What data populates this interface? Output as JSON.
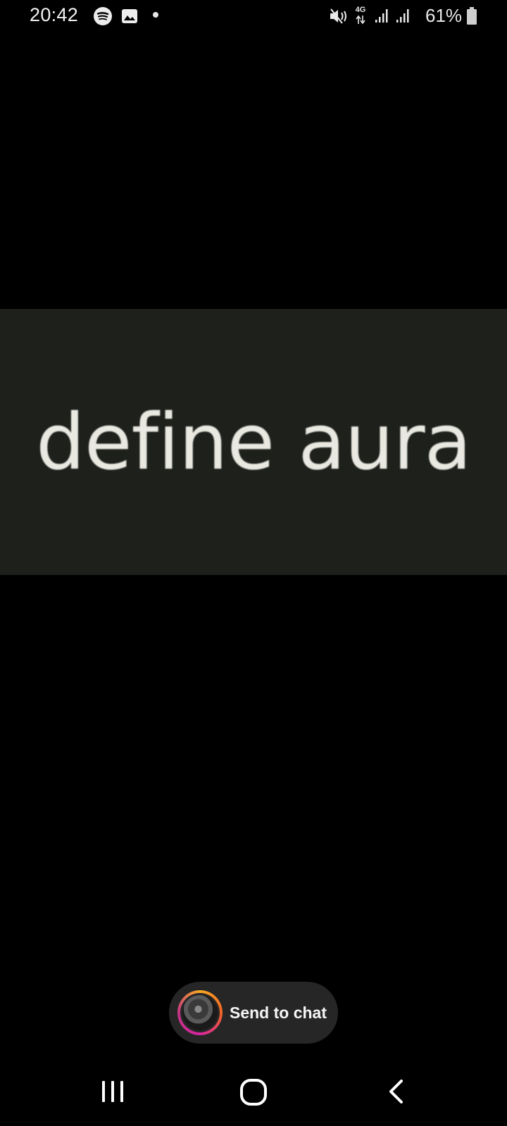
{
  "status_bar": {
    "time": "20:42",
    "network_type": "4G",
    "battery_percent": "61%",
    "icons": [
      "spotify-icon",
      "gallery-icon",
      "notification-dot-icon",
      "mute-icon",
      "network-arrows-icon",
      "signal-icon",
      "signal-icon",
      "battery-icon"
    ]
  },
  "story": {
    "image_text": "define aura"
  },
  "send_to_chat": {
    "label": "Send to chat"
  },
  "nav_bar": {
    "icons": [
      "recent-apps-icon",
      "home-icon",
      "back-icon"
    ]
  },
  "colors": {
    "background": "#000000",
    "image_background": "#1e201c",
    "pill_background": "#262626",
    "ring_gradient": [
      "#f9a825",
      "#f06423",
      "#d6249f"
    ]
  }
}
